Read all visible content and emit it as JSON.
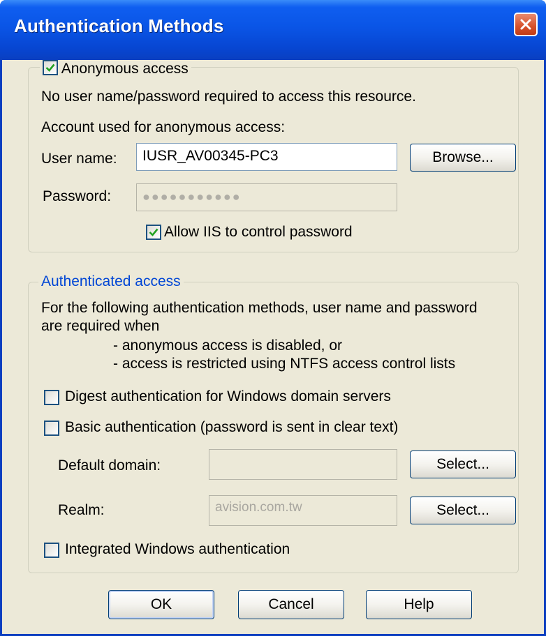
{
  "window": {
    "title": "Authentication Methods"
  },
  "anonymous": {
    "checkbox_label": "Anonymous access",
    "checked": true,
    "description": "No user name/password required to access this resource.",
    "account_label": "Account used for anonymous access:",
    "username_label": "User name:",
    "username_value": "IUSR_AV00345-PC3",
    "browse_label": "Browse...",
    "password_label": "Password:",
    "password_mask": "●●●●●●●●●●●",
    "allow_iis_label": "Allow IIS to control password",
    "allow_iis_checked": true
  },
  "authenticated": {
    "legend": "Authenticated access",
    "desc_line1": "For the following authentication methods, user name and password",
    "desc_line2": "are required when",
    "desc_line3": "- anonymous access is disabled, or",
    "desc_line4": "- access is restricted using NTFS access control lists",
    "digest_label": "Digest authentication for Windows domain servers",
    "digest_checked": false,
    "basic_label": "Basic authentication (password is sent in clear text)",
    "basic_checked": false,
    "default_domain_label": "Default domain:",
    "default_domain_value": "",
    "select1_label": "Select...",
    "realm_label": "Realm:",
    "realm_value": "avision.com.tw",
    "select2_label": "Select...",
    "integrated_label": "Integrated Windows authentication",
    "integrated_checked": false
  },
  "buttons": {
    "ok": "OK",
    "cancel": "Cancel",
    "help": "Help"
  },
  "colors": {
    "titlebar": "#0a55e6",
    "legend_blue": "#0046d5",
    "checkmark": "#21a121",
    "close_red": "#d6512b"
  }
}
